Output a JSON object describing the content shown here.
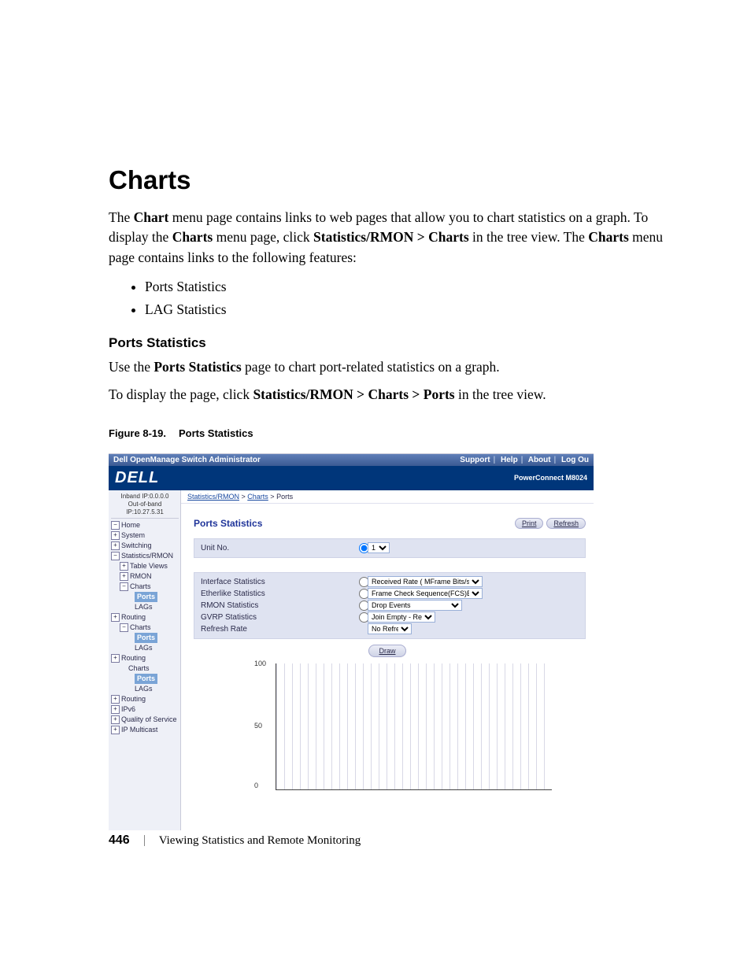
{
  "page": {
    "h1": "Charts",
    "p1_a": "The ",
    "p1_b": "Chart",
    "p1_c": " menu page contains links to web pages that allow you to chart statistics on a graph. To display the ",
    "p1_d": "Charts",
    "p1_e": " menu page, click ",
    "p1_f": "Statistics/RMON > Charts",
    "p1_g": " in the tree view. The ",
    "p1_h": "Charts",
    "p1_i": " menu page contains links to the following features:",
    "bullets": [
      "Ports Statistics",
      "LAG Statistics"
    ],
    "h2": "Ports Statistics",
    "p2_a": "Use the ",
    "p2_b": "Ports Statistics",
    "p2_c": " page to chart port-related statistics on a graph.",
    "p3_a": "To display the page, click ",
    "p3_b": "Statistics/RMON > Charts > Ports",
    "p3_c": " in the tree view.",
    "fig_num": "Figure 8-19.",
    "fig_title": "Ports Statistics"
  },
  "shot": {
    "titlebar": "Dell OpenManage Switch Administrator",
    "toplinks": [
      "Support",
      "Help",
      "About",
      "Log Ou"
    ],
    "brand": "DELL",
    "model": "PowerConnect M8024",
    "ip1": "Inband IP:0.0.0.0",
    "ip2": "Out-of-band IP:10.27.5.31",
    "tree": {
      "home": "Home",
      "system": "System",
      "switching": "Switching",
      "stats": "Statistics/RMON",
      "table_views": "Table Views",
      "rmon": "RMON",
      "charts": "Charts",
      "ports": "Ports",
      "lags": "LAGs",
      "routing": "Routing",
      "ipv6": "IPv6",
      "qos": "Quality of Service",
      "ipmc": "IP Multicast"
    },
    "crumbs": {
      "a": "Statistics/RMON",
      "b": "Charts",
      "c": "Ports"
    },
    "panel_title": "Ports Statistics",
    "btn_print": "Print",
    "btn_refresh": "Refresh",
    "rows": {
      "unit": "Unit No.",
      "if_stats": "Interface Statistics",
      "eth_stats": "Etherlike Statistics",
      "rmon_stats": "RMON Statistics",
      "gvrp_stats": "GVRP Statistics",
      "refresh": "Refresh Rate"
    },
    "selects": {
      "unit": "1",
      "if": "Received Rate ( MFrame Bits/sec )",
      "eth": "Frame Check Sequence(FCS)Errors",
      "rmon": "Drop Events",
      "gvrp": "Join Empty - Receive",
      "refresh": "No Refresh"
    },
    "draw": "Draw",
    "yticks": {
      "t100": "100",
      "t50": "50",
      "t0": "0"
    }
  },
  "footer": {
    "pagenum": "446",
    "section": "Viewing Statistics and Remote Monitoring"
  }
}
